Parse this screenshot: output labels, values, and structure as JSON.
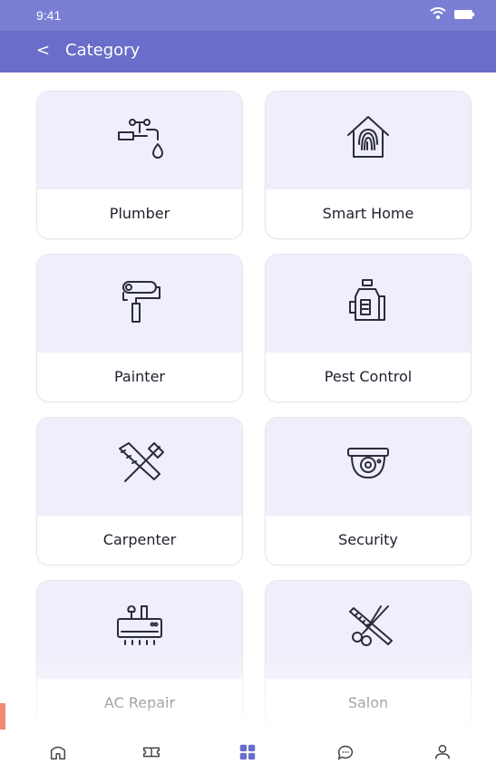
{
  "status": {
    "time": "9:41"
  },
  "header": {
    "back_label": "<",
    "title": "Category"
  },
  "categories": [
    {
      "label": "Plumber",
      "icon": "faucet-icon"
    },
    {
      "label": "Smart Home",
      "icon": "smart-home-fingerprint-icon"
    },
    {
      "label": "Painter",
      "icon": "paint-roller-icon"
    },
    {
      "label": "Pest Control",
      "icon": "sprayer-icon"
    },
    {
      "label": "Carpenter",
      "icon": "saw-hammer-icon"
    },
    {
      "label": "Security",
      "icon": "security-camera-icon"
    },
    {
      "label": "AC Repair",
      "icon": "ac-repair-icon"
    },
    {
      "label": "Salon",
      "icon": "scissors-comb-icon"
    }
  ],
  "tabbar": {
    "items": [
      {
        "name": "home",
        "icon": "home-icon"
      },
      {
        "name": "tickets",
        "icon": "ticket-icon"
      },
      {
        "name": "category",
        "icon": "grid-icon",
        "active": true
      },
      {
        "name": "messages",
        "icon": "chat-icon"
      },
      {
        "name": "profile",
        "icon": "user-icon"
      }
    ]
  },
  "colors": {
    "header": "#7b7fd4",
    "card_top": "#eeeffa",
    "active_tab": "#6a6dc9",
    "icon_stroke": "#2b2b3a"
  }
}
